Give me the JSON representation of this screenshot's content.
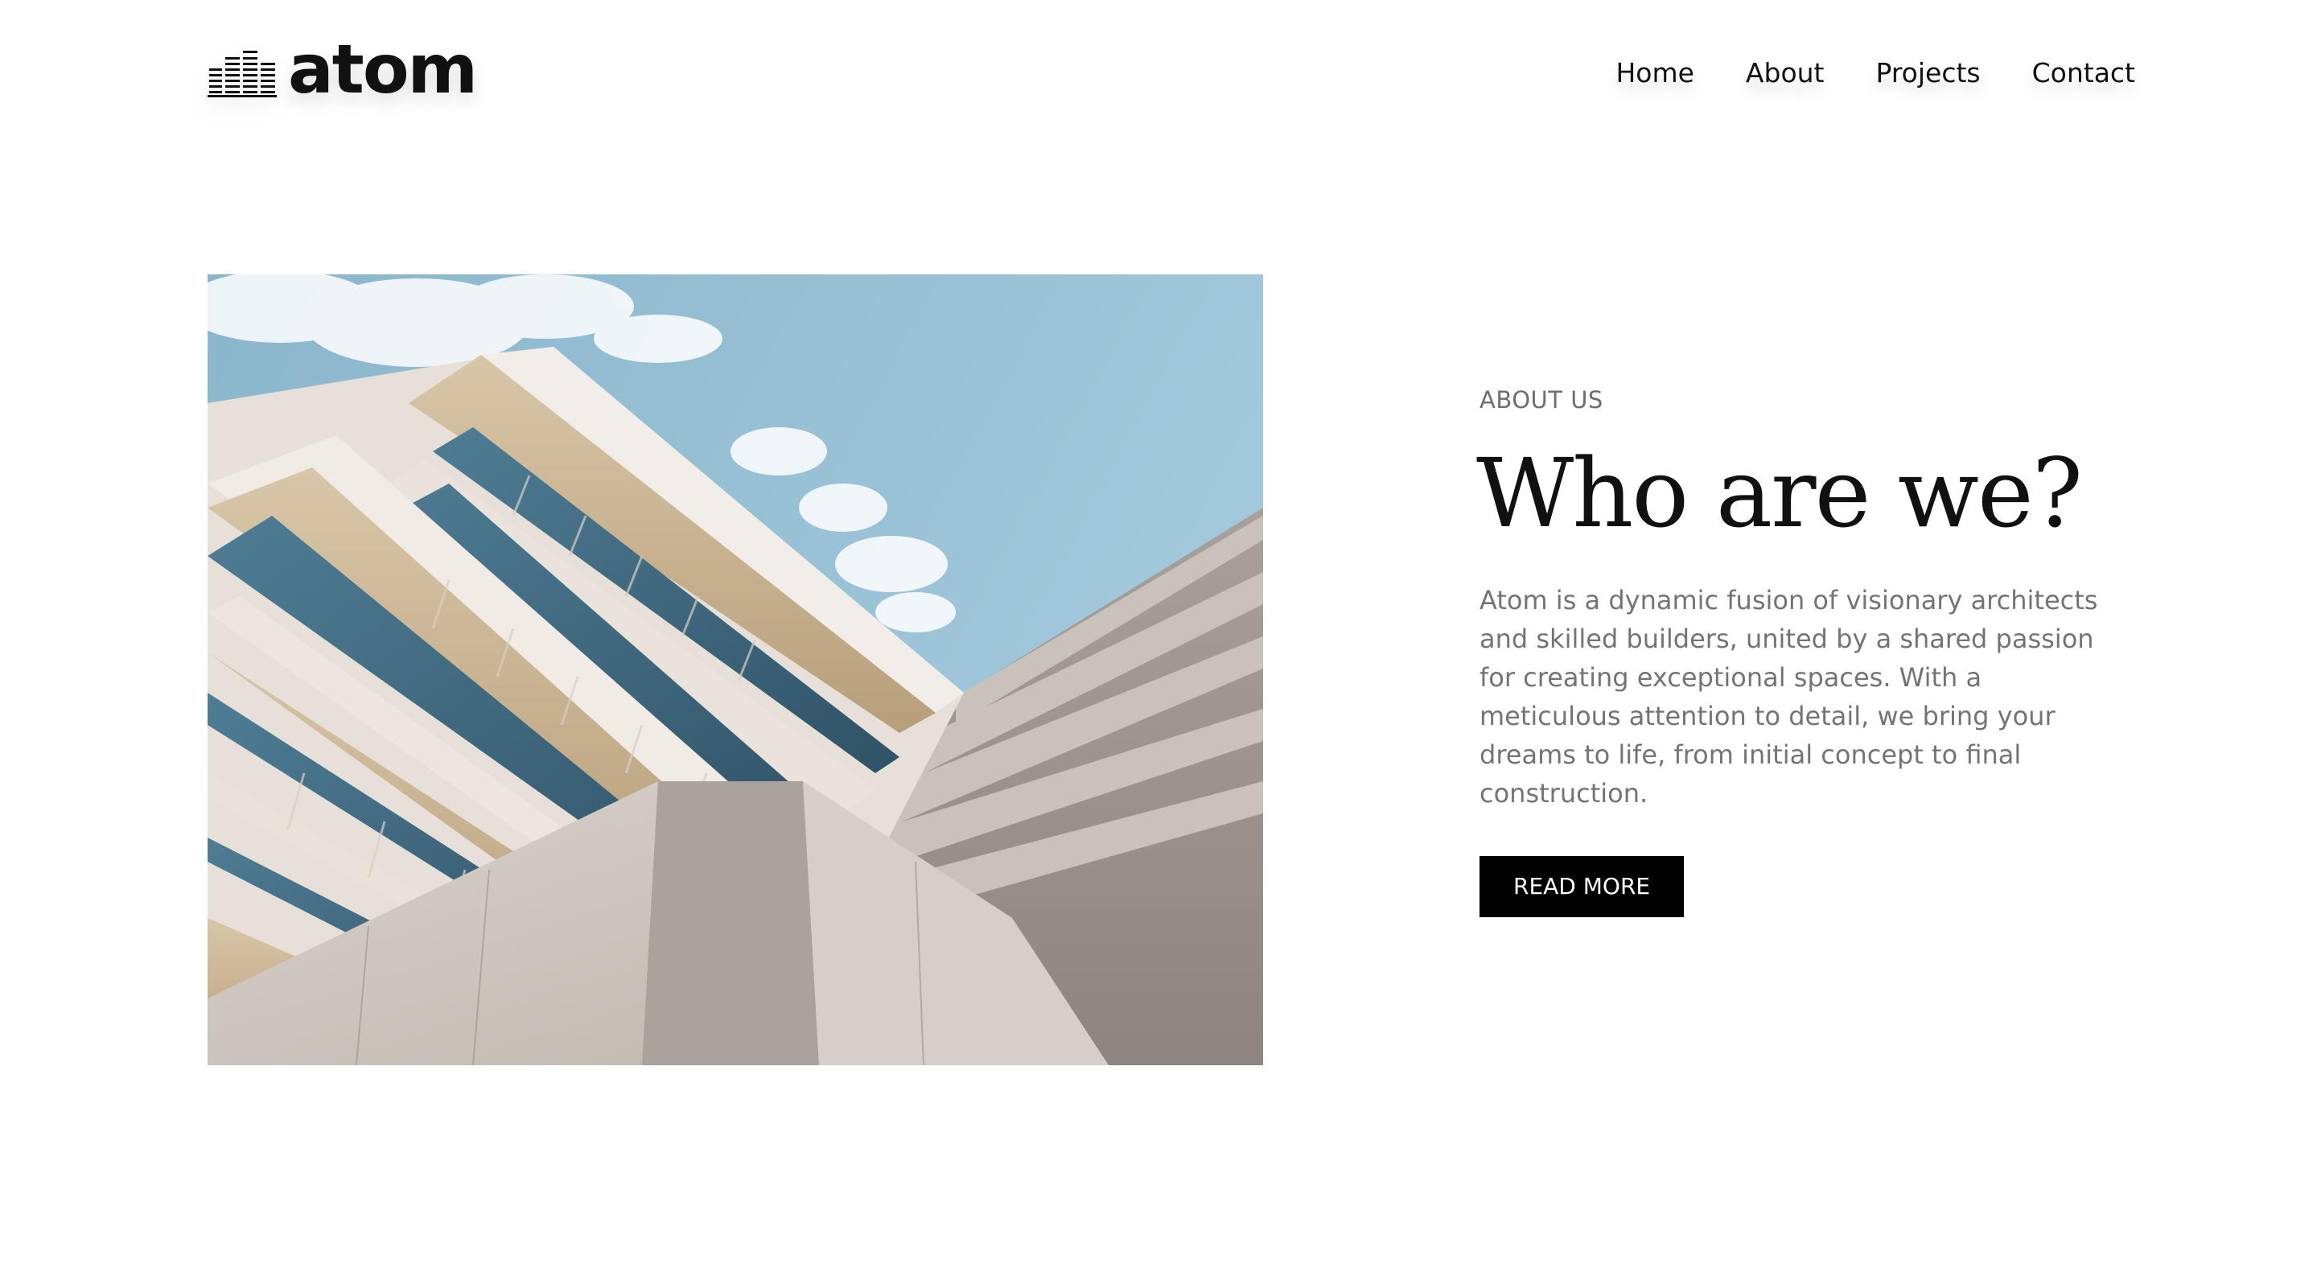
{
  "header": {
    "logo_text": "atom",
    "logo_icon": "buildings-icon",
    "nav": [
      {
        "label": "Home"
      },
      {
        "label": "About"
      },
      {
        "label": "Projects"
      },
      {
        "label": "Contact"
      }
    ]
  },
  "hero": {
    "image_subject": "modern-building-photo"
  },
  "about": {
    "eyebrow": "ABOUT US",
    "title": "Who are we?",
    "body": "Atom is a dynamic fusion of visionary architects and skilled builders, united by a shared passion for creating exceptional spaces. With a meticulous attention to detail, we bring your dreams to life, from initial concept to final construction.",
    "button_label": "READ MORE"
  },
  "colors": {
    "text": "#111111",
    "muted": "#747474",
    "button_bg": "#000000",
    "button_text": "#ffffff",
    "sky": "#8fb9cf"
  }
}
